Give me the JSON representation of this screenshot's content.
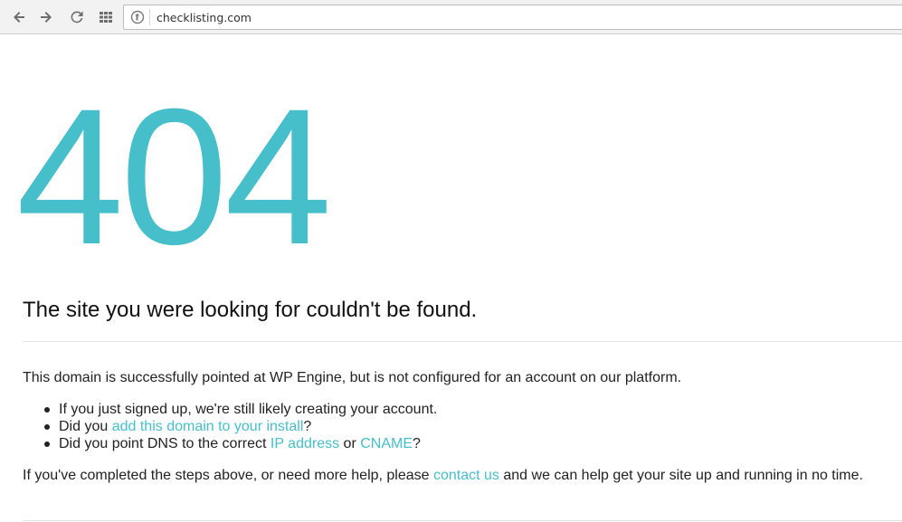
{
  "browser": {
    "url": "checklisting.com",
    "nav": {
      "back_icon": "arrow-left-icon",
      "forward_icon": "arrow-right-icon",
      "reload_icon": "reload-icon",
      "apps_icon": "apps-grid-icon",
      "site_info_icon": "site-info-icon"
    }
  },
  "page": {
    "code": "404",
    "headline": "The site you were looking for couldn't be found.",
    "intro": "This domain is successfully pointed at WP Engine, but is not configured for an account on our platform.",
    "steps": {
      "item1": "If you just signed up, we're still likely creating your account.",
      "item2_prefix": "Did you ",
      "item2_link": "add this domain to your install",
      "item2_suffix": "?",
      "item3_prefix": "Did you point DNS to the correct ",
      "item3_link1": "IP address",
      "item3_middle": " or ",
      "item3_link2": "CNAME",
      "item3_suffix": "?"
    },
    "help": {
      "prefix": "If you've completed the steps above, or need more help, please ",
      "link": "contact us",
      "suffix": " and we can help get your site up and running in no time."
    }
  },
  "colors": {
    "accent": "#46bfcb",
    "text": "#222222",
    "rule": "#e3e3e3"
  }
}
